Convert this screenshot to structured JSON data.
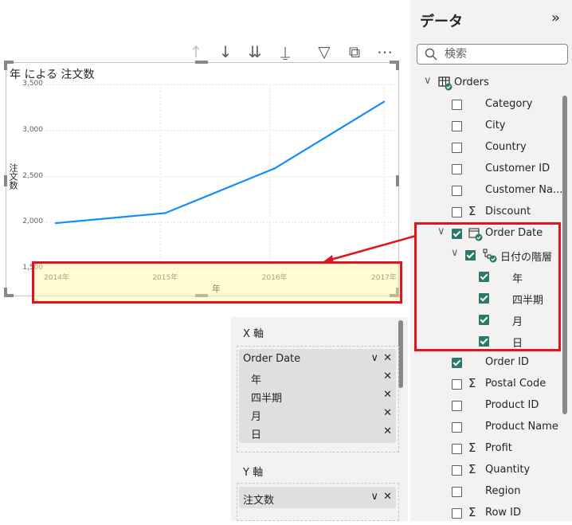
{
  "visual": {
    "title": "年 による 注文数",
    "toolbar": [
      {
        "icon": "arrow-up-icon",
        "glyph": "↑",
        "enabled": false
      },
      {
        "icon": "arrow-down-icon",
        "glyph": "↓",
        "enabled": true
      },
      {
        "icon": "double-arrow-down-icon",
        "glyph": "⇊",
        "enabled": true
      },
      {
        "icon": "expand-hierarchy-icon",
        "glyph": "⍊",
        "enabled": true
      },
      {
        "icon": "filter-icon",
        "glyph": "▽",
        "enabled": true
      },
      {
        "icon": "focus-mode-icon",
        "glyph": "⧉",
        "enabled": true
      },
      {
        "icon": "more-options-icon",
        "glyph": "⋯",
        "enabled": true
      }
    ]
  },
  "chart_data": {
    "type": "line",
    "title": "年 による 注文数",
    "xlabel": "年",
    "ylabel": "注文数",
    "x": [
      "2014年",
      "2015年",
      "2016年",
      "2017年"
    ],
    "series": [
      {
        "values": [
          1993,
          2102,
          2587,
          3312
        ],
        "color": "#118dff"
      }
    ],
    "ylim": [
      1500,
      3500
    ],
    "yticks": [
      "1,500",
      "2,000",
      "2,500",
      "3,000",
      "3,500"
    ],
    "grid": true
  },
  "data_pane": {
    "title": "データ",
    "collapse_icon": "»",
    "search_placeholder": "検索",
    "table_name": "Orders",
    "fields": [
      {
        "label": "Category",
        "checked": false,
        "sigma": false
      },
      {
        "label": "City",
        "checked": false,
        "sigma": false
      },
      {
        "label": "Country",
        "checked": false,
        "sigma": false
      },
      {
        "label": "Customer ID",
        "checked": false,
        "sigma": false
      },
      {
        "label": "Customer Na...",
        "checked": false,
        "sigma": false
      },
      {
        "label": "Discount",
        "checked": false,
        "sigma": true
      },
      {
        "label": "Order Date",
        "checked": true,
        "sigma": false
      },
      {
        "label": "日付の階層",
        "checked": true,
        "sigma": false
      },
      {
        "label": "年",
        "checked": true,
        "sigma": false
      },
      {
        "label": "四半期",
        "checked": true,
        "sigma": false
      },
      {
        "label": "月",
        "checked": true,
        "sigma": false
      },
      {
        "label": "日",
        "checked": true,
        "sigma": false
      },
      {
        "label": "Order ID",
        "checked": true,
        "sigma": false
      },
      {
        "label": "Postal Code",
        "checked": false,
        "sigma": true
      },
      {
        "label": "Product ID",
        "checked": false,
        "sigma": false
      },
      {
        "label": "Product Name",
        "checked": false,
        "sigma": false
      },
      {
        "label": "Profit",
        "checked": false,
        "sigma": true
      },
      {
        "label": "Quantity",
        "checked": false,
        "sigma": true
      },
      {
        "label": "Region",
        "checked": false,
        "sigma": false
      },
      {
        "label": "Row ID",
        "checked": false,
        "sigma": true
      }
    ]
  },
  "wells": {
    "x_axis": {
      "title": "X 軸",
      "field": "Order Date",
      "items": [
        "年",
        "四半期",
        "月",
        "日"
      ]
    },
    "y_axis": {
      "title": "Y 軸",
      "field": "注文数"
    }
  },
  "colors": {
    "highlight": "#e0141e",
    "check": "#2a7a6b",
    "line": "#118dff"
  }
}
